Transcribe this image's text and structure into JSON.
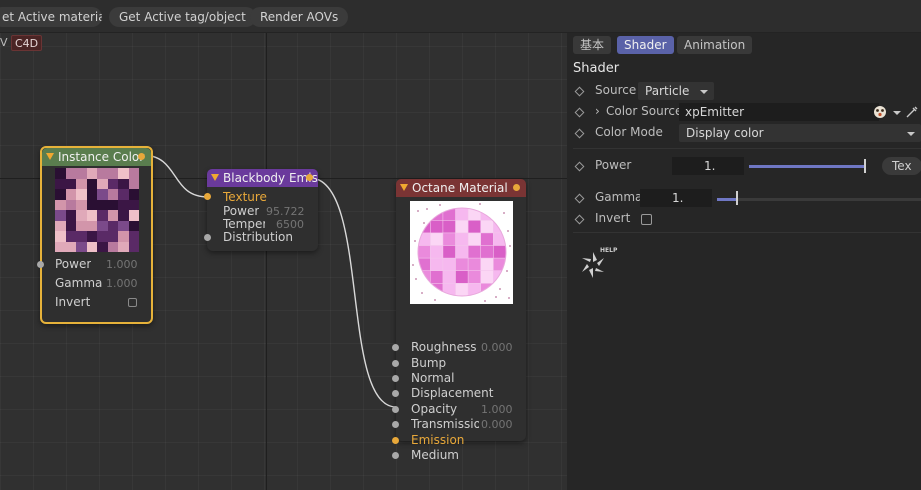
{
  "toolbar": {
    "buttons": [
      "et Active material",
      "Get Active tag/object",
      "Render AOVs"
    ]
  },
  "editor": {
    "tag_v": "V",
    "tag_c4d": "C4D",
    "nodes": {
      "instance_color": {
        "title": "Instance Color",
        "header_color": "#5a7d4e",
        "border_color": "#e6b23a",
        "ports": [
          {
            "label": "Power",
            "value": "1.000"
          },
          {
            "label": "Gamma",
            "value": "1.000"
          },
          {
            "label": "Invert"
          }
        ]
      },
      "blackbody": {
        "title": "Blackbody Emission",
        "header_color": "#6a3a9c",
        "ports": [
          {
            "label": "Texture"
          },
          {
            "label": "Power",
            "value": "95.722"
          },
          {
            "label": "Temperature",
            "value": "6500"
          },
          {
            "label": "Distribution"
          }
        ]
      },
      "octane_material": {
        "title": "Octane Material",
        "header_color": "#7a3434",
        "ports": [
          {
            "label": "Roughness",
            "value": "0.000"
          },
          {
            "label": "Bump"
          },
          {
            "label": "Normal"
          },
          {
            "label": "Displacement"
          },
          {
            "label": "Opacity",
            "value": "1.000"
          },
          {
            "label": "Transmission",
            "value": "0.000"
          },
          {
            "label": "Emission"
          },
          {
            "label": "Medium"
          }
        ]
      }
    }
  },
  "panel": {
    "tabs": [
      "基本",
      "Shader",
      "Animation"
    ],
    "active_tab": "Shader",
    "title": "Shader",
    "rows": {
      "source": {
        "label": "Source",
        "value": "Particle"
      },
      "color_source": {
        "label": "Color Source",
        "value": "xpEmitter"
      },
      "color_mode": {
        "label": "Color Mode",
        "value": "Display color"
      },
      "power": {
        "label": "Power",
        "value": "1.",
        "level": 1.0,
        "button": "Tex"
      },
      "gamma": {
        "label": "Gamma",
        "value": "1.",
        "level": 0.1
      },
      "invert": {
        "label": "Invert",
        "checked": false
      }
    },
    "help_label": "HELP",
    "accent_color": "#5a62a8"
  }
}
